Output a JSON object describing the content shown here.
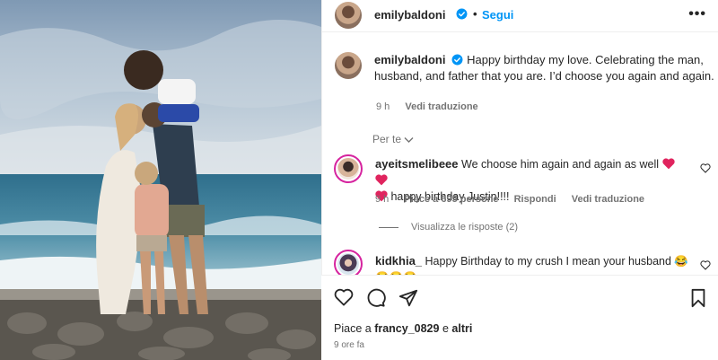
{
  "post": {
    "username": "emilybaldoni",
    "separator": "•",
    "follow_label": "Segui",
    "more_label": "•••"
  },
  "caption": {
    "username": "emilybaldoni",
    "text": "Happy birthday my love. Celebrating the man, husband, and father that you are. I’d choose you again and again.",
    "time": "9 h",
    "translate": "Vedi traduzione"
  },
  "per_te": "Per te",
  "comments": [
    {
      "username": "ayeitsmelibeee",
      "text": "We choose him again and again as well",
      "text2": "happy birthday Justin!!!!",
      "time": "9 h",
      "likes": "Piace a 695 persone",
      "reply": "Rispondi",
      "translate": "Vedi traduzione",
      "view_replies": "Visualizza le risposte (2)"
    },
    {
      "username": "kidkhia_",
      "text": "Happy Birthday to my crush I mean your husband 😂",
      "emoji_row": "😂😂😂"
    }
  ],
  "likes": {
    "prefix": "Piace a",
    "user": "francy_0829",
    "joiner": "e",
    "others": "altri"
  },
  "posted_ago": "9 ore fa",
  "icons": [
    "heart-icon",
    "comment-icon",
    "share-icon",
    "bookmark-icon",
    "verified-icon",
    "chevron-down-icon"
  ],
  "colors": {
    "accent": "#0095f6",
    "heart": "#e0245e",
    "muted": "#737373"
  }
}
